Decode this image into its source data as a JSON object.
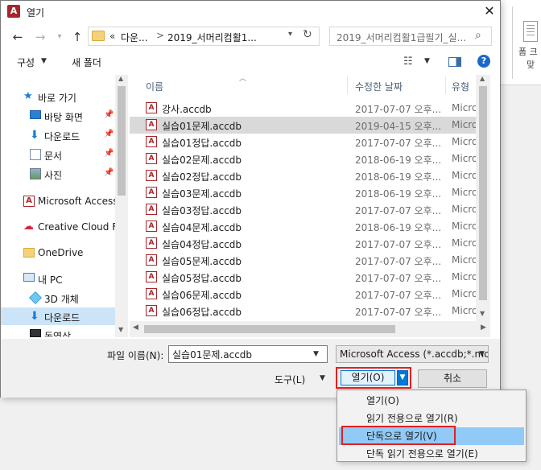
{
  "window": {
    "title": "열기",
    "app_icon_letter": "A"
  },
  "background_app": {
    "ribbon_text1": "폼 크",
    "ribbon_text2": "맞"
  },
  "navigation": {
    "address": {
      "overflow": "«",
      "segment1": "다운...",
      "separator": ">",
      "segment2": "2019_서머리컴활1..."
    },
    "search_placeholder": "2019_서머리컴활1급필기_실..."
  },
  "toolbar": {
    "organize_label": "구성",
    "new_folder_label": "새 폴더"
  },
  "sidebar": {
    "items": [
      {
        "label": "바로 가기",
        "icon": "star-icon"
      },
      {
        "label": "바탕 화면",
        "icon": "desktop-icon"
      },
      {
        "label": "다운로드",
        "icon": "download-icon"
      },
      {
        "label": "문서",
        "icon": "document-icon"
      },
      {
        "label": "사진",
        "icon": "pictures-icon"
      },
      {
        "label": "Microsoft Access",
        "icon": "access-icon"
      },
      {
        "label": "Creative Cloud Fil",
        "icon": "creative-cloud-icon"
      },
      {
        "label": "OneDrive",
        "icon": "folder-icon"
      },
      {
        "label": "내 PC",
        "icon": "pc-icon"
      },
      {
        "label": "3D 개체",
        "icon": "cube-icon"
      },
      {
        "label": "다운로드",
        "icon": "download-icon"
      },
      {
        "label": "동영상",
        "icon": "film-icon"
      }
    ]
  },
  "filelist": {
    "columns": [
      "이름",
      "수정한 날짜",
      "유형"
    ],
    "rows": [
      {
        "name": "강사.accdb",
        "date": "2017-07-07 오후...",
        "type": "Microsof"
      },
      {
        "name": "실습01문제.accdb",
        "date": "2019-04-15 오후...",
        "type": "Microsof"
      },
      {
        "name": "실습01정답.accdb",
        "date": "2017-07-07 오후...",
        "type": "Microsof"
      },
      {
        "name": "실습02문제.accdb",
        "date": "2018-06-19 오후...",
        "type": "Microsof"
      },
      {
        "name": "실습02정답.accdb",
        "date": "2018-06-19 오후...",
        "type": "Microsof"
      },
      {
        "name": "실습03문제.accdb",
        "date": "2018-06-19 오후...",
        "type": "Microsof"
      },
      {
        "name": "실습03정답.accdb",
        "date": "2017-07-07 오후...",
        "type": "Microsof"
      },
      {
        "name": "실습04문제.accdb",
        "date": "2018-06-19 오후...",
        "type": "Microsof"
      },
      {
        "name": "실습04정답.accdb",
        "date": "2017-07-07 오후...",
        "type": "Microsof"
      },
      {
        "name": "실습05문제.accdb",
        "date": "2017-07-07 오후...",
        "type": "Microsof"
      },
      {
        "name": "실습05정답.accdb",
        "date": "2017-07-07 오후...",
        "type": "Microsof"
      },
      {
        "name": "실습06문제.accdb",
        "date": "2017-07-07 오후...",
        "type": "Microsof"
      },
      {
        "name": "실습06정답.accdb",
        "date": "2017-07-07 오후...",
        "type": "Microsof"
      }
    ],
    "selected_name": "실습01문제.accdb"
  },
  "bottom": {
    "filename_label": "파일 이름(N):",
    "filename_value": "실습01문제.accdb",
    "filter_value": "Microsoft Access (*.accdb;*.mc",
    "tools_label": "도구(L)",
    "open_label": "열기(O)",
    "cancel_label": "취소"
  },
  "open_menu": {
    "items": [
      "열기(O)",
      "읽기 전용으로 열기(R)",
      "단독으로 열기(V)",
      "단독 읽기 전용으로 열기(E)"
    ],
    "highlighted": "단독으로 열기(V)"
  },
  "colors": {
    "accent": "#0078d7",
    "selection": "#cce4f7",
    "menu_highlight": "#91c9f7",
    "annotation_red": "#e02020"
  }
}
